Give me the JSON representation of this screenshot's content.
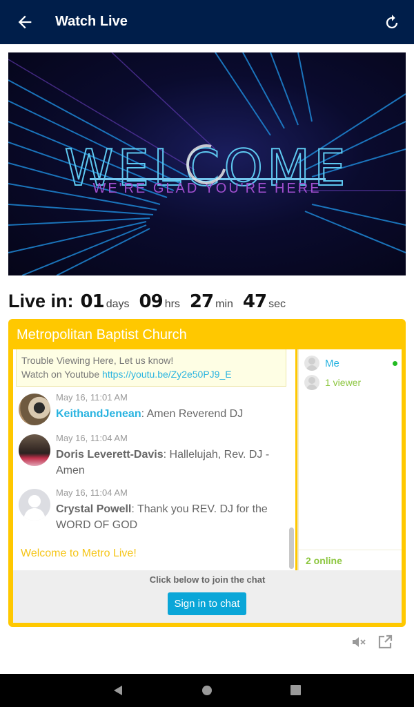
{
  "appbar": {
    "title": "Watch Live",
    "back_icon": "arrow-left-icon",
    "refresh_icon": "refresh-icon"
  },
  "video": {
    "headline": "WELCOME",
    "subline": "WE'RE GLAD YOU'RE HERE",
    "state": "loading"
  },
  "countdown": {
    "label": "Live in:",
    "days": "01",
    "days_unit": "days",
    "hours": "09",
    "hours_unit": "hrs",
    "minutes": "27",
    "minutes_unit": "min",
    "seconds": "47",
    "seconds_unit": "sec"
  },
  "chat": {
    "title": "Metropolitan Baptist Church",
    "notice": {
      "line1": "Trouble Viewing Here, Let us know!",
      "line2_prefix": "Watch on Youtube ",
      "link": "https://youtu.be/Zy2e50PJ9_E"
    },
    "messages": [
      {
        "time": "May 16, 11:01 AM",
        "author": "KeithandJenean",
        "text": ": Amen Reverend DJ"
      },
      {
        "time": "May 16, 11:04 AM",
        "author": "Doris Leverett-Davis",
        "text": ": Hallelujah, Rev. DJ - Amen"
      },
      {
        "time": "May 16, 11:04 AM",
        "author": "Crystal Powell",
        "text": ": Thank you REV. DJ for the WORD OF GOD"
      }
    ],
    "welcome": "Welcome to Metro Live!",
    "users": {
      "me": "Me",
      "viewers": "1 viewer",
      "online": "2 online"
    },
    "join_hint": "Click below to join the chat",
    "sign_in": "Sign in to chat"
  },
  "controls": {
    "mute_icon": "volume-mute-icon",
    "popout_icon": "external-link-icon"
  },
  "colors": {
    "appbar": "#001e4a",
    "accent_yellow": "#ffc800",
    "link_blue": "#28b3e0",
    "button_blue": "#0aa6d8",
    "online_green": "#8cc63f"
  }
}
